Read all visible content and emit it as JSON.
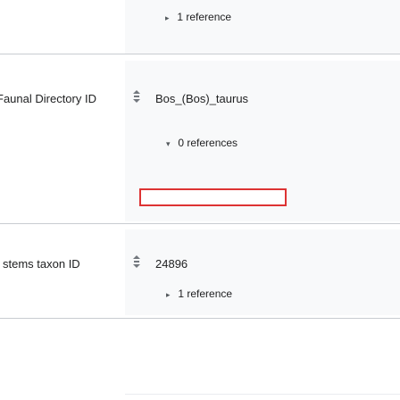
{
  "statements": [
    {
      "property_label": "",
      "value": "",
      "references_label": "1 reference",
      "references_expanded": false
    },
    {
      "property_label": "Faunal Directory ID",
      "value": "Bos_(Bos)_taurus",
      "references_label": "0 references",
      "references_expanded": true
    },
    {
      "property_label": "stems taxon ID",
      "value": "24896",
      "references_label": "1 reference",
      "references_expanded": false
    }
  ],
  "icons": {
    "rank": "normal-rank-icon",
    "collapsed_arrow": "▸",
    "expanded_arrow": "▾"
  },
  "colors": {
    "value_background": "#f8f9fa",
    "divider": "#c8ccd1",
    "highlight_border": "#d33"
  }
}
